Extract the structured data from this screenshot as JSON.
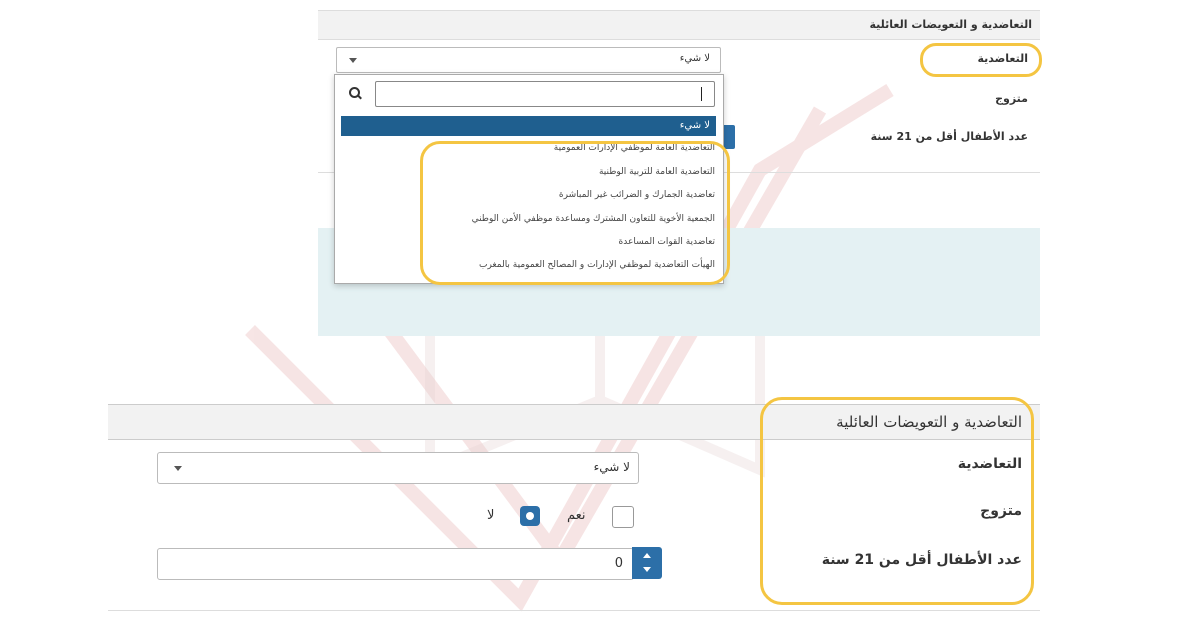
{
  "top_form": {
    "section_title": "التعاضدية و التعويضات العائلية",
    "mutuelle_label": "التعاضدية",
    "married_label": "متزوج",
    "children_label": "عدد الأطفال أقل من 21 سنة",
    "select_value": "لا شيء",
    "dropdown": {
      "selected": "لا شيء",
      "options": [
        "التعاضدية العامة لموظفي الإدارات العمومية",
        "التعاضدية العامة للتربية الوطنية",
        "تعاضدية الجمارك و الضرائب غير المباشرة",
        "الجمعية الأخوية للتعاون المشترك ومساعدة موظفي الأمن الوطني",
        "تعاضدية القوات المساعدة",
        "الهيأت التعاضدية لموظفي الإدارات و المصالح العمومية بالمغرب"
      ]
    }
  },
  "bottom_form": {
    "section_title": "التعاضدية و التعويضات العائلية",
    "mutuelle_label": "التعاضدية",
    "married_label": "متزوج",
    "children_label": "عدد الأطفال أقل من 21 سنة",
    "select_value": "لا شيء",
    "yes_label": "نعم",
    "no_label": "لا",
    "married_value": "لا",
    "children_value": "0"
  },
  "colors": {
    "accent": "#2c6fa8",
    "highlight": "#f4c542",
    "selected_option": "#1f5f8f"
  }
}
